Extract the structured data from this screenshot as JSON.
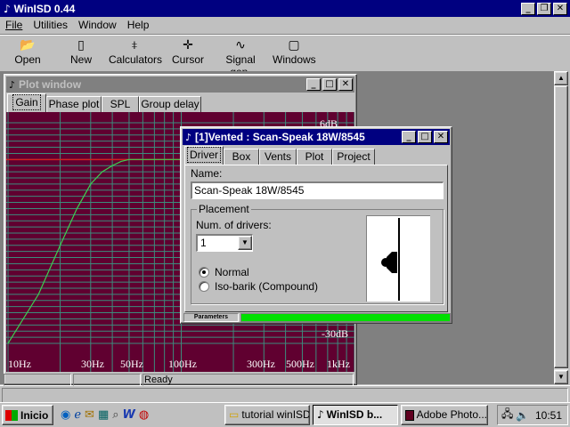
{
  "app": {
    "title": "WinISD 0.44"
  },
  "menu": {
    "file": "File",
    "utilities": "Utilities",
    "window": "Window",
    "help": "Help"
  },
  "toolbar": {
    "open": "Open",
    "new": "New",
    "calculators": "Calculators",
    "cursor": "Cursor",
    "signal_gen": "Signal gen.",
    "windows": "Windows"
  },
  "plot_window": {
    "title": "Plot window",
    "tabs": [
      "Gain",
      "Phase plot",
      "SPL",
      "Group delay"
    ],
    "y_labels": {
      "top": "6dB",
      "bottom": "-30dB"
    },
    "x_labels": [
      "10Hz",
      "30Hz",
      "50Hz",
      "100Hz",
      "300Hz",
      "500Hz",
      "1kHz"
    ]
  },
  "chart_data": {
    "type": "line",
    "title": "",
    "xlabel": "",
    "ylabel": "",
    "x_scale": "log",
    "xlim": [
      10,
      1000
    ],
    "ylim": [
      -30,
      6
    ],
    "grid": true,
    "series": [
      {
        "x": [
          10,
          15,
          20,
          25,
          30,
          35,
          40,
          45,
          50,
          60,
          1000
        ],
        "y": [
          -30,
          -22,
          -14,
          -8,
          -4,
          -2,
          -1,
          -0.3,
          0,
          0,
          0
        ]
      }
    ],
    "colors": {
      "background": "#600030",
      "grid": "#3c8c7c",
      "curve": "#3cd050",
      "reference": "#d02020"
    }
  },
  "vented_dialog": {
    "title": "[1]Vented : Scan-Speak 18W/8545",
    "tabs": [
      "Driver",
      "Box",
      "Vents",
      "Plot",
      "Project"
    ],
    "name_label": "Name:",
    "name_value": "Scan-Speak 18W/8545",
    "placement_label": "Placement",
    "num_drivers_label": "Num. of drivers:",
    "num_drivers_value": "1",
    "radio_normal": "Normal",
    "radio_isobarik": "Iso-barik (Compound)",
    "parameters_label": "Parameters"
  },
  "status": {
    "ready": "Ready"
  },
  "taskbar": {
    "start": "Inicio",
    "tasks": [
      "tutorial winISD",
      "WinISD b...",
      "Adobe Photo..."
    ],
    "clock": "10:51"
  }
}
